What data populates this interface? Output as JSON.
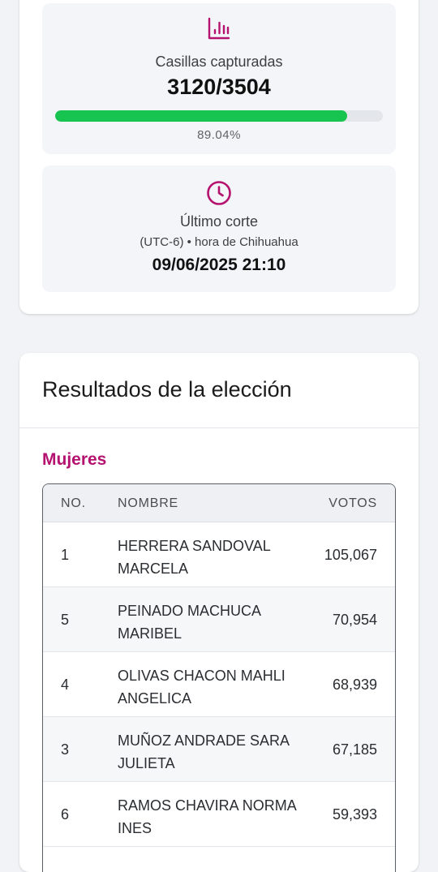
{
  "progress": {
    "label": "Casillas capturadas",
    "value": "3120/3504",
    "percent_text": "89.04%",
    "fraction": 0.8904,
    "icon": "bar-chart-icon",
    "accent": "#b5126f",
    "bar_color": "#17c44f"
  },
  "cut": {
    "label": "Último corte",
    "timezone": "(UTC-6) • hora de Chihuahua",
    "datetime": "09/06/2025 21:10",
    "icon": "clock-icon"
  },
  "results": {
    "title": "Resultados de la elección",
    "section": "Mujeres",
    "columns": {
      "no": "NO.",
      "name": "NOMBRE",
      "votes": "VOTOS"
    },
    "rows": [
      {
        "no": "1",
        "name": "HERRERA SANDOVAL MARCELA",
        "votes": "105,067"
      },
      {
        "no": "5",
        "name": "PEINADO MACHUCA MARIBEL",
        "votes": "70,954"
      },
      {
        "no": "4",
        "name": "OLIVAS CHACON MAHLI ANGELICA",
        "votes": "68,939"
      },
      {
        "no": "3",
        "name": "MUÑOZ ANDRADE SARA JULIETA",
        "votes": "67,185"
      },
      {
        "no": "6",
        "name": "RAMOS CHAVIRA NORMA INES",
        "votes": "59,393"
      }
    ]
  }
}
